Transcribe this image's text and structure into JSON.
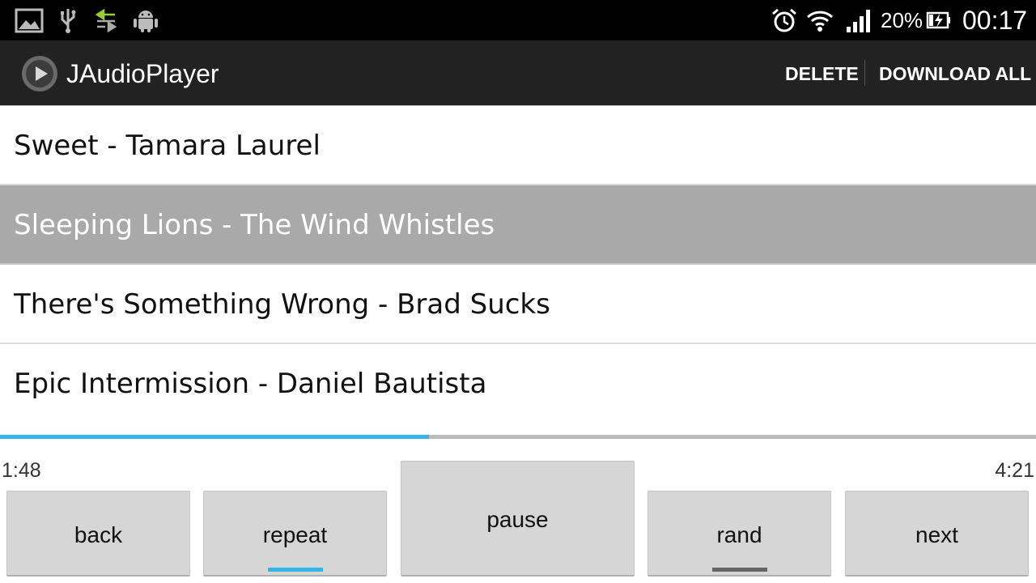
{
  "status_bar": {
    "battery_percent": "20%",
    "time": "00:17",
    "notification_icons": [
      "image-icon",
      "usb-icon",
      "sync-icon",
      "android-icon"
    ],
    "system_icons": [
      "alarm-clock-icon",
      "wifi-icon",
      "signal-icon",
      "battery-charging-icon"
    ]
  },
  "action_bar": {
    "title": "JAudioPlayer",
    "delete_label": "DELETE",
    "download_all_label": "DOWNLOAD ALL"
  },
  "tracks": [
    {
      "label": "Sweet - Tamara Laurel",
      "selected": false
    },
    {
      "label": "Sleeping Lions - The Wind Whistles",
      "selected": true
    },
    {
      "label": "There's Something Wrong - Brad Sucks",
      "selected": false
    },
    {
      "label": "Epic Intermission - Daniel Bautista",
      "selected": false
    }
  ],
  "player": {
    "elapsed": "1:48",
    "total": "4:21",
    "progress_fraction": 0.414
  },
  "controls": {
    "back_label": "back",
    "repeat_label": "repeat",
    "pause_label": "pause",
    "rand_label": "rand",
    "next_label": "next",
    "repeat_on": true,
    "rand_on": false
  },
  "colors": {
    "accent": "#33b5e5",
    "toggle_off": "#666666",
    "selected_row": "#a9a9a9",
    "action_bar": "#222222"
  }
}
